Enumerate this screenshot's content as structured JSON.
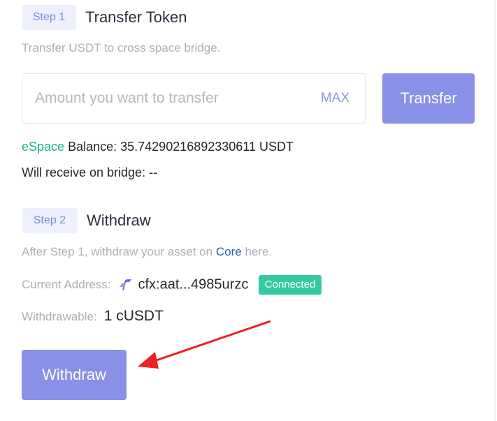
{
  "step1": {
    "badge": "Step 1",
    "title": "Transfer Token",
    "description": "Transfer USDT to cross space bridge.",
    "amount_input": {
      "value": "",
      "placeholder": "Amount you want to transfer"
    },
    "max_label": "MAX",
    "transfer_label": "Transfer",
    "balance": {
      "space": "eSpace",
      "label": " Balance: ",
      "value": "35.74290216892330611 USDT"
    },
    "receive": {
      "label": "Will receive on bridge: ",
      "value": "--"
    }
  },
  "step2": {
    "badge": "Step 2",
    "title": "Withdraw",
    "description_prefix": "After Step 1, withdraw your asset on ",
    "description_link": "Core",
    "description_suffix": " here.",
    "address_label": "Current Address:",
    "address_value": "cfx:aat...4985urzc",
    "connected_label": "Connected",
    "withdrawable_label": "Withdrawable:",
    "withdrawable_value": "1 cUSDT",
    "withdraw_label": "Withdraw"
  },
  "colors": {
    "accent": "#8890e8",
    "espace_green": "#1fb27e",
    "connected_teal": "#35c9a2",
    "annotation_arrow": "#ee2222"
  },
  "icons": {
    "address_icon": "fluent-wallet-icon",
    "annotation": "red-arrow-annotation"
  }
}
